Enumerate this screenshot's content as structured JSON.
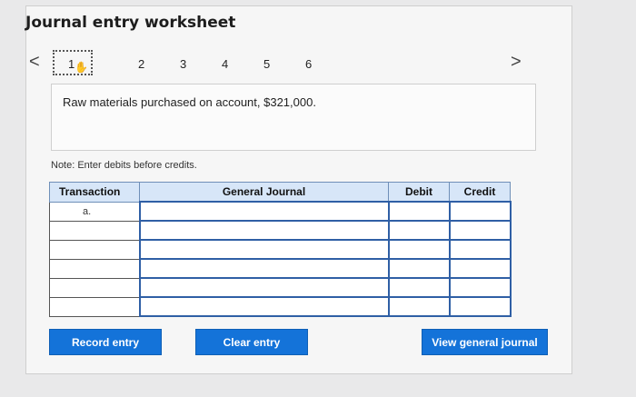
{
  "title": "Journal entry worksheet",
  "pager": {
    "prev": "<",
    "next": ">",
    "pages": [
      "1",
      "2",
      "3",
      "4",
      "5",
      "6"
    ],
    "active": "1"
  },
  "prompt_text": "Raw materials purchased on account, $321,000.",
  "note": "Note: Enter debits before credits.",
  "table": {
    "headers": [
      "Transaction",
      "General Journal",
      "Debit",
      "Credit"
    ],
    "rows": [
      {
        "transaction": "a.",
        "account": "",
        "debit": "",
        "credit": ""
      },
      {
        "transaction": "",
        "account": "",
        "debit": "",
        "credit": ""
      },
      {
        "transaction": "",
        "account": "",
        "debit": "",
        "credit": ""
      },
      {
        "transaction": "",
        "account": "",
        "debit": "",
        "credit": ""
      },
      {
        "transaction": "",
        "account": "",
        "debit": "",
        "credit": ""
      },
      {
        "transaction": "",
        "account": "",
        "debit": "",
        "credit": ""
      }
    ]
  },
  "buttons": {
    "record": "Record entry",
    "clear": "Clear entry",
    "view": "View general journal"
  },
  "colors": {
    "header_bg": "#d7e6f8",
    "button": "#1473d9",
    "input_border": "#2f5fa5"
  },
  "icons": [
    "chevron-left-icon",
    "chevron-right-icon",
    "hand-cursor-icon"
  ]
}
